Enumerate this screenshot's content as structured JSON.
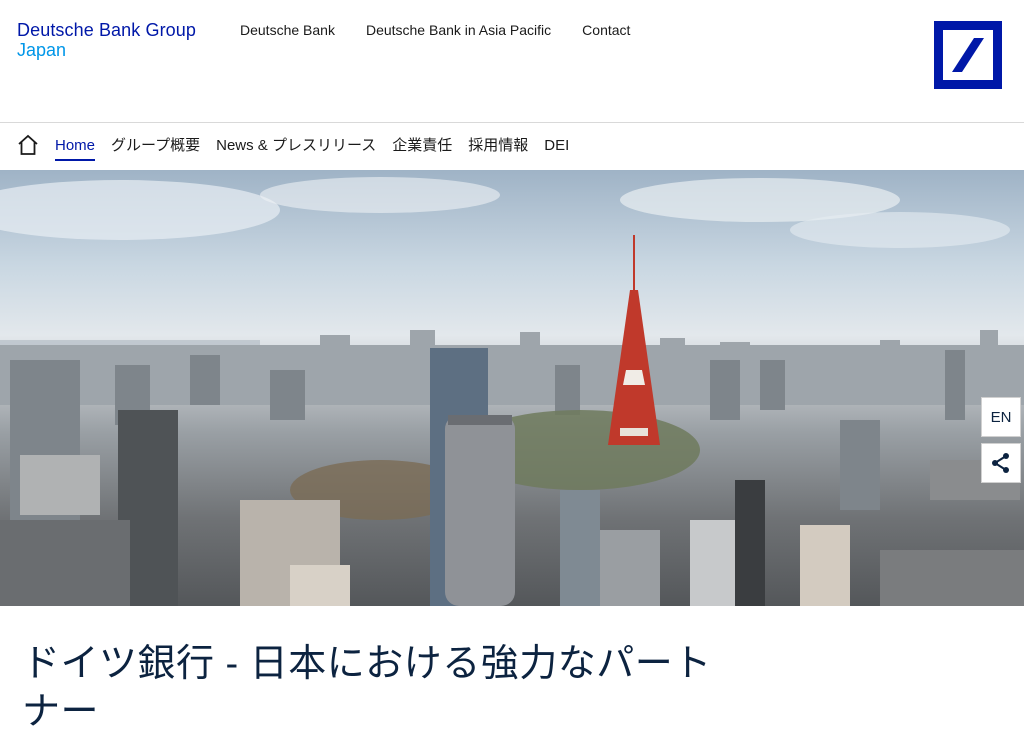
{
  "brand": {
    "line1": "Deutsche Bank Group",
    "line2": "Japan"
  },
  "top_links": [
    "Deutsche Bank",
    "Deutsche Bank in Asia Pacific",
    "Contact"
  ],
  "nav": {
    "items": [
      {
        "label": "Home",
        "active": true
      },
      {
        "label": "グループ概要",
        "active": false
      },
      {
        "label": "News & プレスリリース",
        "active": false
      },
      {
        "label": "企業責任",
        "active": false
      },
      {
        "label": "採用情報",
        "active": false
      },
      {
        "label": "DEI",
        "active": false
      }
    ]
  },
  "side_buttons": {
    "language": "EN",
    "share_icon": "share-icon"
  },
  "headline": "ドイツ銀行 - 日本における強力なパートナー",
  "colors": {
    "brand_blue": "#0018a8",
    "brand_light_blue": "#0096e8",
    "text_dark": "#0c2340"
  },
  "icons": {
    "home": "home-icon",
    "logo": "deutsche-bank-logo"
  }
}
